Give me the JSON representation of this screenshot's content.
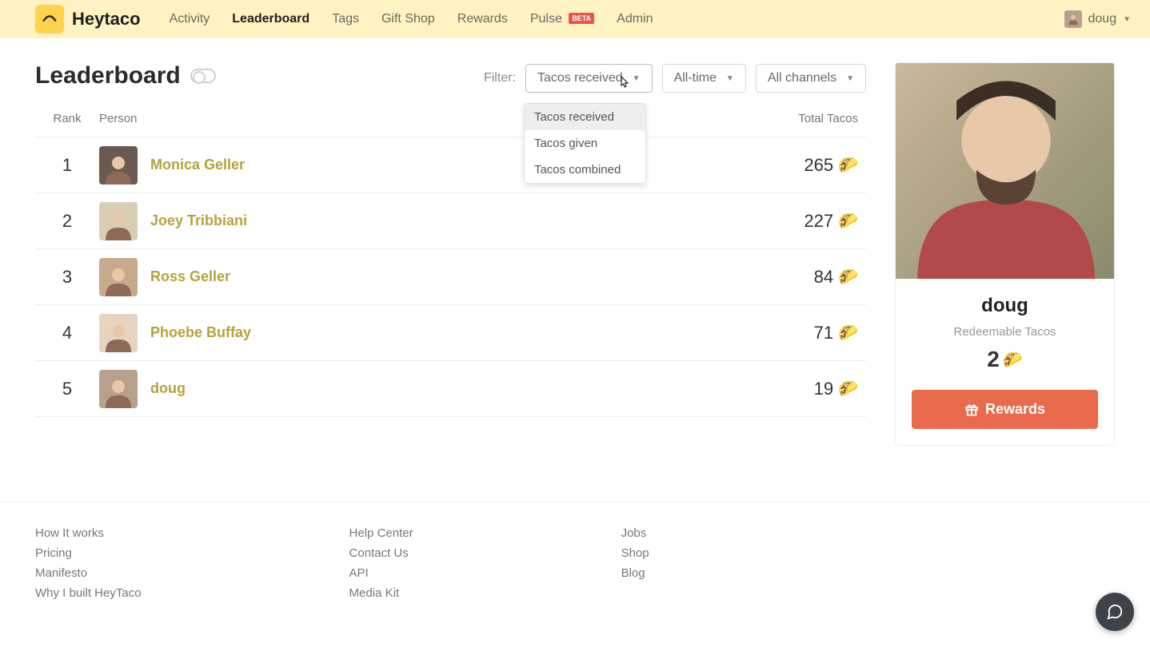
{
  "brand": "Heytaco",
  "nav": {
    "activity": "Activity",
    "leaderboard": "Leaderboard",
    "tags": "Tags",
    "giftshop": "Gift Shop",
    "rewards": "Rewards",
    "pulse": "Pulse",
    "pulse_badge": "BETA",
    "admin": "Admin"
  },
  "user": {
    "name": "doug"
  },
  "page": {
    "title": "Leaderboard"
  },
  "filters": {
    "label": "Filter:",
    "type": {
      "selected": "Tacos received",
      "options": [
        "Tacos received",
        "Tacos given",
        "Tacos combined"
      ]
    },
    "time": {
      "selected": "All-time"
    },
    "channel": {
      "selected": "All channels"
    }
  },
  "table": {
    "headers": {
      "rank": "Rank",
      "person": "Person",
      "total": "Total Tacos"
    },
    "rows": [
      {
        "rank": "1",
        "name": "Monica Geller",
        "total": "265",
        "avatarBg": "#6b5a52"
      },
      {
        "rank": "2",
        "name": "Joey Tribbiani",
        "total": "227",
        "avatarBg": "#d9cdb6"
      },
      {
        "rank": "3",
        "name": "Ross Geller",
        "total": "84",
        "avatarBg": "#c7aa8c"
      },
      {
        "rank": "4",
        "name": "Phoebe Buffay",
        "total": "71",
        "avatarBg": "#e6d3c0"
      },
      {
        "rank": "5",
        "name": "doug",
        "total": "19",
        "avatarBg": "#b7a18c"
      }
    ]
  },
  "sidebar": {
    "name": "doug",
    "sub": "Redeemable Tacos",
    "count": "2",
    "button": "Rewards"
  },
  "footer": {
    "col1": [
      "How It works",
      "Pricing",
      "Manifesto",
      "Why I built HeyTaco"
    ],
    "col2": [
      "Help Center",
      "Contact Us",
      "API",
      "Media Kit"
    ],
    "col3": [
      "Jobs",
      "Shop",
      "Blog"
    ]
  },
  "icons": {
    "taco": "🌮"
  }
}
